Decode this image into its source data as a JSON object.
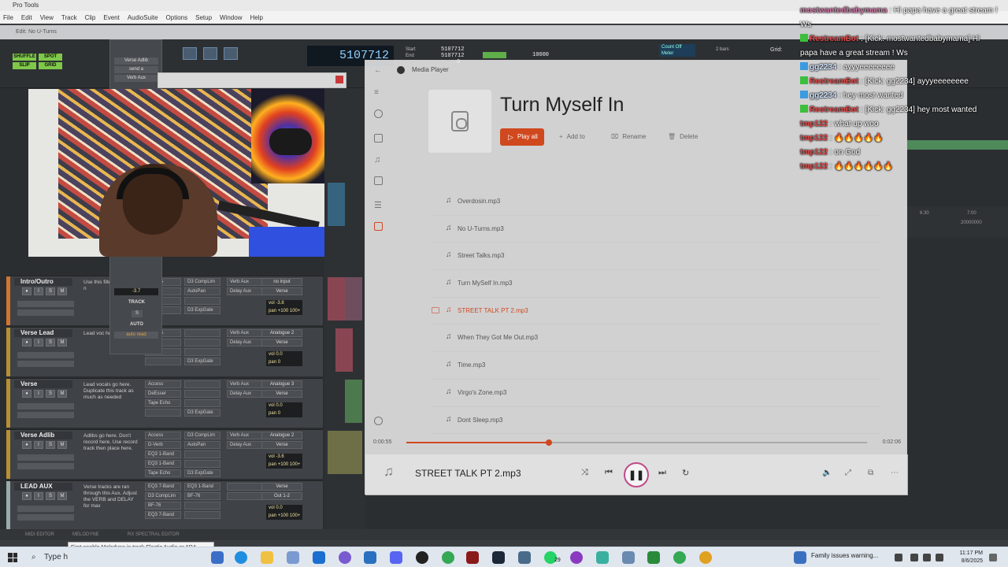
{
  "protools": {
    "title": "Pro Tools",
    "menu": [
      "File",
      "Edit",
      "View",
      "Track",
      "Clip",
      "Event",
      "AudioSuite",
      "Options",
      "Setup",
      "Window",
      "Help"
    ],
    "edit_window_title": "Edit: No U-Turns",
    "modes": [
      "SHUFFLE",
      "SPOT",
      "SLIP",
      "GRID"
    ],
    "counter": "5107712",
    "start_label": "Start",
    "end_label": "End",
    "start_val": "5107712",
    "end_val": "5107712",
    "length_val": "0",
    "nudge_val": "10000",
    "count_off": "Count Off",
    "meter": "Meter",
    "bars": "2 bars",
    "grid_label": "Grid:",
    "send_window": {
      "header": "Verse Adlib",
      "send": "send a",
      "aux": "Verb Aux",
      "value": "-3.7",
      "track": "TRACK",
      "s": "S",
      "auto": "AUTO",
      "mode": "auto read"
    },
    "tracks": [
      {
        "name": "Intro/Outro",
        "color": "#d2742f",
        "comment": "Use this filter for outro if n",
        "inserts": [
          "Access",
          "Band",
          "Band",
          "Echo"
        ],
        "inserts2": [
          "D3 CompLim",
          "AutoPan",
          "",
          "D3 ExpGate"
        ],
        "sends": [
          "Verb Aux",
          "Delay Aux"
        ],
        "io": [
          "no input",
          "Verse"
        ],
        "vol": "-3.8",
        "pan": "+100 100+"
      },
      {
        "name": "Verse Lead",
        "color": "#b98f33",
        "comment": "Lead voc here.",
        "inserts": [
          "Access",
          "Esser",
          "Echo",
          ""
        ],
        "inserts2": [
          "",
          "",
          "",
          "D3 ExpGate"
        ],
        "sends": [
          "Verb Aux",
          "Delay Aux"
        ],
        "io": [
          "Analogue 2",
          "Verse"
        ],
        "vol": "0.0",
        "pan": "0"
      },
      {
        "name": "Verse",
        "color": "#b98f33",
        "comment": "Lead vocals go here. Duplicate this track as much as needed",
        "inserts": [
          "Access",
          "DeEsser",
          "Tape Echo",
          ""
        ],
        "inserts2": [
          "",
          "",
          "",
          "D3 ExpGate"
        ],
        "sends": [
          "Verb Aux",
          "Delay Aux"
        ],
        "io": [
          "Analogue 3",
          "Verse"
        ],
        "vol": "0.0",
        "pan": "0"
      },
      {
        "name": "Verse Adlib",
        "color": "#b98f33",
        "comment": "Adlibs go here. Don't record here. Use record track then place here.",
        "inserts": [
          "Access",
          "D-Verb",
          "EQ3 1-Band",
          "EQ3 1-Band",
          "Tape Echo"
        ],
        "inserts2": [
          "D3 CompLim",
          "AutoPan",
          "",
          "",
          "D3 ExpGate"
        ],
        "sends": [
          "Verb Aux",
          "Delay Aux"
        ],
        "io": [
          "Analogue 2",
          "Verse"
        ],
        "vol": "-3.6",
        "pan": "+100 100+"
      },
      {
        "name": "LEAD AUX",
        "color": "#9aa",
        "comment": "Verse tracks are ran through this Aux. Adjust the VERB and DELAY for max",
        "inserts": [
          "EQ3 7-Band",
          "D3 CompLim",
          "BF-76",
          "EQ3 7-Band"
        ],
        "inserts2": [
          "EQ3 1-Band",
          "BF-76",
          "",
          ""
        ],
        "sends": [
          "",
          ""
        ],
        "io": [
          "Verse",
          "Out 1-2"
        ],
        "vol": "0.0",
        "pan": "+100 100+"
      }
    ],
    "ruler_ticks": [
      "6:30",
      "7:00",
      "20000000"
    ],
    "bottom_tabs": [
      "MIDI EDITOR",
      "MELODYNE",
      "RX SPECTRAL EDITOR"
    ],
    "tooltip": "First enable Melodyne in track Elastic Audio or ARA plugin selector"
  },
  "media_player": {
    "app_title": "Media Player",
    "playlist_title": "Turn Myself In",
    "play_all_label": "Play all",
    "add_to_label": "Add to",
    "rename_label": "Rename",
    "delete_label": "Delete",
    "tracks": [
      "Overdosin.mp3",
      "No U-Turns.mp3",
      "Street Talks.mp3",
      "Turn MySelf In.mp3",
      "STREET TALK PT 2.mp3",
      "When They Got Me Out.mp3",
      "Time.mp3",
      "Virgo's Zone.mp3",
      "Dont Sleep.mp3"
    ],
    "active_index": 4,
    "current_time": "0:00:55",
    "total_time": "0:02:06",
    "progress": 0.31,
    "now_playing": "STREET TALK PT 2.mp3",
    "accent": "#d0481e"
  },
  "chat": [
    {
      "user": "mostwantedbabymama",
      "user_color": "#d07aa8",
      "badge": "",
      "text": ": Hi papa have a great stream ! Ws",
      "wrap": true
    },
    {
      "user": "RestreamBot",
      "user_color": "#e24a4a",
      "badge": "green",
      "text": ": [Kick: mostwantedbabymama] Hi papa have a great stream ! Ws",
      "wrap": true
    },
    {
      "user": "gg2234",
      "user_color": "#cfe3ff",
      "badge": "blue",
      "text": ": ayyyeeeeeeee",
      "wrap": false
    },
    {
      "user": "RestreamBot",
      "user_color": "#e24a4a",
      "badge": "green",
      "text": ": [Kick: gg2234] ayyyeeeeeeee",
      "wrap": false
    },
    {
      "user": "gg2234",
      "user_color": "#cfe3ff",
      "badge": "blue",
      "text": ": hey most wanted",
      "wrap": false
    },
    {
      "user": "RestreamBot",
      "user_color": "#e24a4a",
      "badge": "green",
      "text": ": [Kick: gg2234] hey most wanted",
      "wrap": false
    },
    {
      "user": "tmp122",
      "user_color": "#e24a4a",
      "badge": "",
      "text": ": what up woo",
      "wrap": false
    },
    {
      "user": "tmp122",
      "user_color": "#e24a4a",
      "badge": "",
      "text": ": 🔥🔥🔥🔥🔥",
      "wrap": false
    },
    {
      "user": "tmp122",
      "user_color": "#e24a4a",
      "badge": "",
      "text": ": on God",
      "wrap": false
    },
    {
      "user": "tmp122",
      "user_color": "#e24a4a",
      "badge": "",
      "text": ": 🔥🔥🔥🔥🔥🔥",
      "wrap": false
    }
  ],
  "taskbar": {
    "search_placeholder": "Type h",
    "badge_count": "29",
    "notice": "Family issues warning...",
    "time": "11:17 PM",
    "date": "8/6/2025"
  }
}
